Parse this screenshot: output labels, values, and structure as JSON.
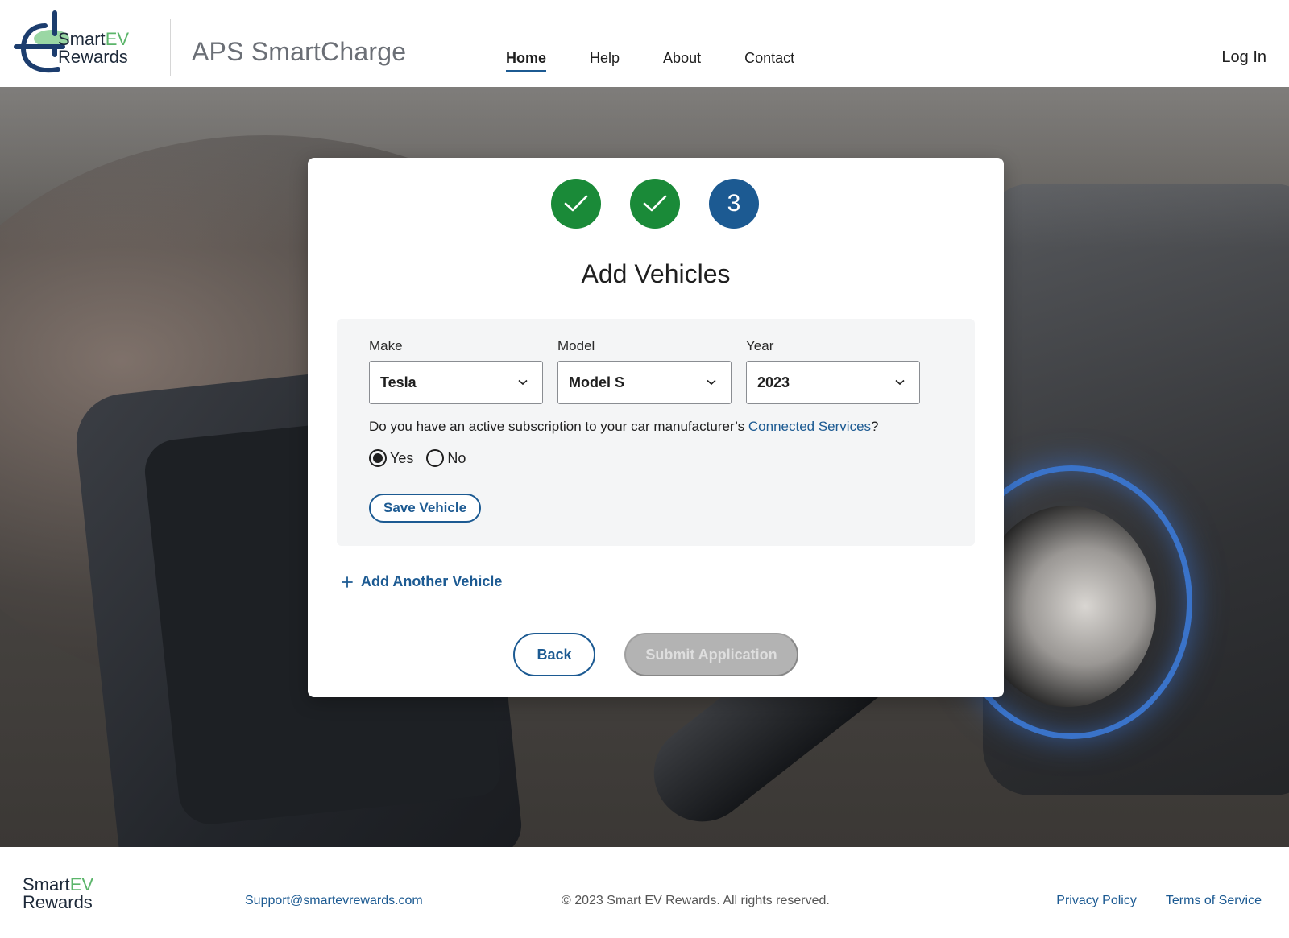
{
  "header": {
    "logo": {
      "line1": "Smart",
      "line1_accent": "EV",
      "line2": "Rewards"
    },
    "app_title": "APS SmartCharge",
    "nav": [
      {
        "label": "Home",
        "active": true
      },
      {
        "label": "Help",
        "active": false
      },
      {
        "label": "About",
        "active": false
      },
      {
        "label": "Contact",
        "active": false
      }
    ],
    "login_label": "Log In"
  },
  "steps": {
    "items": [
      {
        "state": "complete",
        "icon": "check-icon"
      },
      {
        "state": "complete",
        "icon": "check-icon"
      },
      {
        "state": "current",
        "label": "3"
      }
    ]
  },
  "form": {
    "title": "Add Vehicles",
    "make": {
      "label": "Make",
      "value": "Tesla"
    },
    "model": {
      "label": "Model",
      "value": "Model S"
    },
    "year": {
      "label": "Year",
      "value": "2023"
    },
    "question_prefix": "Do you have an active subscription to your car manufacturer’s ",
    "question_link": "Connected Services",
    "question_suffix": "?",
    "radio_yes": "Yes",
    "radio_no": "No",
    "selected": "Yes",
    "save_label": "Save Vehicle",
    "add_another_label": "Add Another Vehicle",
    "back_label": "Back",
    "submit_label": "Submit Application"
  },
  "footer": {
    "logo": {
      "line1": "Smart",
      "line1_accent": "EV",
      "line2": "Rewards"
    },
    "email": "Support@smartevrewards.com",
    "copyright": "© 2023 Smart EV Rewards. All rights reserved.",
    "privacy_label": "Privacy Policy",
    "terms_label": "Terms of Service"
  },
  "colors": {
    "primary": "#1c5a92",
    "success": "#1a8a38",
    "accent_green": "#5bb56a",
    "disabled": "#b3b3b3"
  }
}
